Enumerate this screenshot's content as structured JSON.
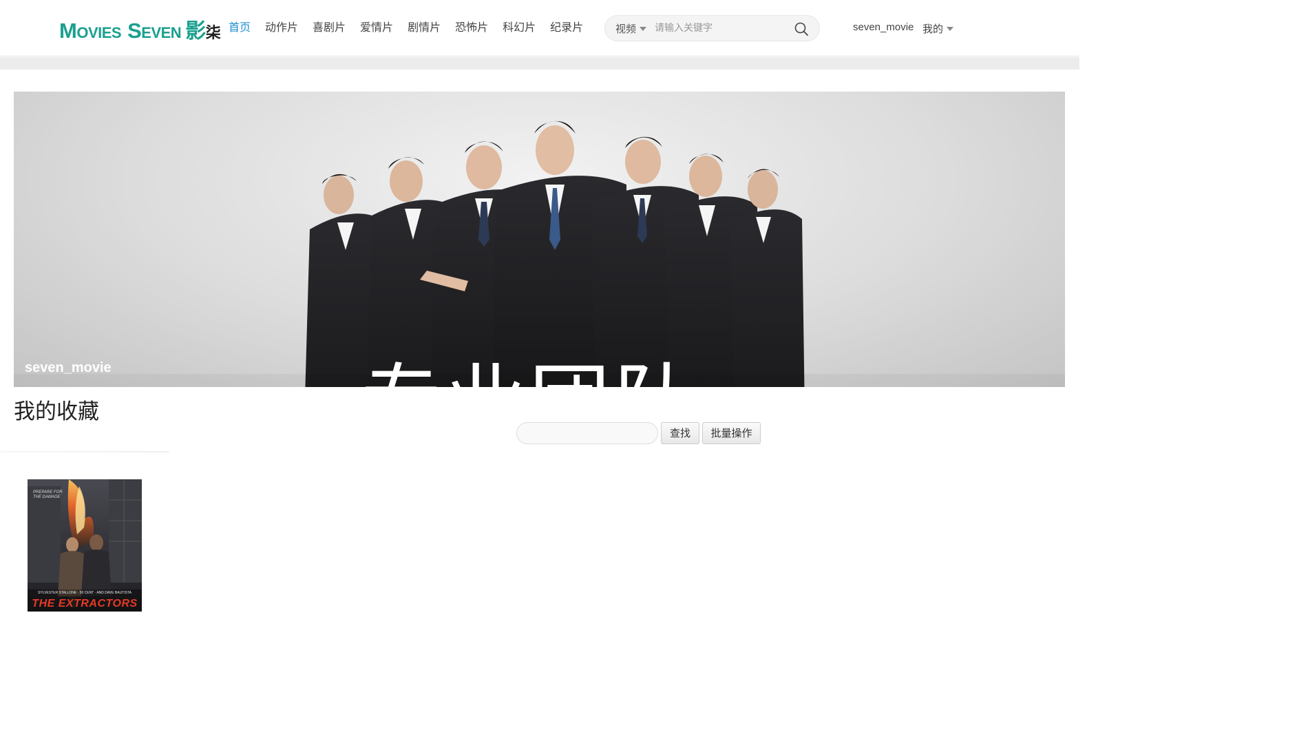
{
  "header": {
    "logo": {
      "part1_big": "M",
      "part1_small": "OVIES",
      "part2_big": "S",
      "part2_small": "EVEN",
      "cn_main": "影",
      "cn_sub": "柒"
    },
    "nav": [
      {
        "label": "首页",
        "active": true
      },
      {
        "label": "动作片",
        "active": false
      },
      {
        "label": "喜剧片",
        "active": false
      },
      {
        "label": "爱情片",
        "active": false
      },
      {
        "label": "剧情片",
        "active": false
      },
      {
        "label": "恐怖片",
        "active": false
      },
      {
        "label": "科幻片",
        "active": false
      },
      {
        "label": "纪录片",
        "active": false
      }
    ],
    "search": {
      "category": "视频",
      "placeholder": "请输入关键字",
      "icon": "search-icon"
    },
    "user_name": "seven_movie",
    "my_menu_label": "我的"
  },
  "banner": {
    "slogan": "专业团队",
    "user_label": "seven_movie"
  },
  "favorites": {
    "title": "我的收藏",
    "search_placeholder": "",
    "find_button": "查找",
    "batch_button": "批量操作",
    "items": [
      {
        "title": "THE EXTRACTORS",
        "tagline": "PREPARE FOR THE DAMAGE",
        "credits": "SYLVESTER STALLONE · 50 CENT · AND DAVE BAUTISTA"
      }
    ]
  },
  "colors": {
    "brand": "#1aa08f",
    "nav_active": "#1e8fd4"
  }
}
